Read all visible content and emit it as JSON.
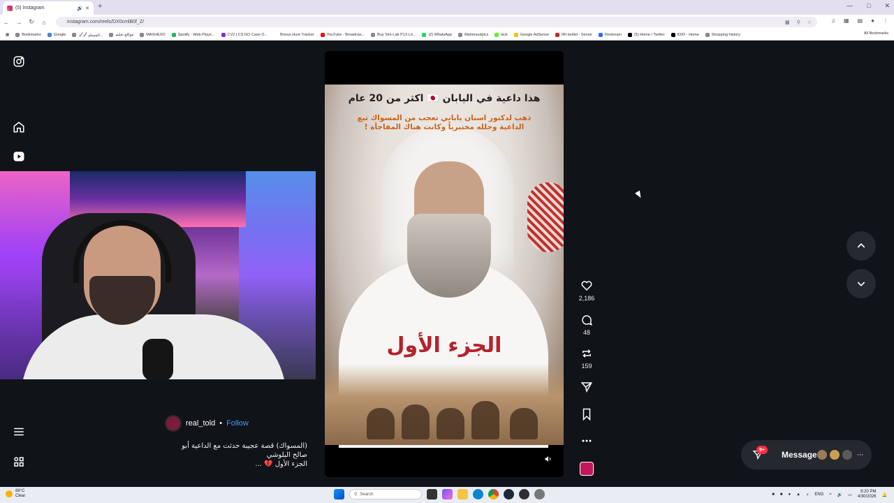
{
  "browser": {
    "tab_title": "(5) Instagram",
    "url": "instagram.com/reels/DX0cmlB0f_Z/",
    "bookmarks": [
      "Bookmarks",
      "Google",
      "المسلم ﷴﷴ...",
      "مواقع تعليم",
      "MAXHEXO",
      "Spotify - Web Playe...",
      "CV2 | CS:GO Case O...",
      "Bonus Hunt Tracker",
      "YouTube - Broadcas...",
      "Buy Sim-Lab P1X Lit...",
      "(2) WhatsApp",
      "Mahmoudpics",
      "kick",
      "Google AdSense",
      "IRI toolkit - Server",
      "Restream",
      "(5) Home / Twitter",
      "IOIO - Home",
      "Shopping history"
    ],
    "all_bookmarks": "All Bookmarks"
  },
  "reel": {
    "overlay_title": "هذا داعية في اليابان 🇯🇵 اكثر من 20 عام",
    "overlay_sub": "ذهب لدكتور اسنان ياباني تعجب من المسواك تبع الداعية وحلله مختبرياً وكانت هناك المفاجأة !",
    "overlay_part": "الجزء الأول",
    "likes": "2,186",
    "comments": "48",
    "reposts": "159"
  },
  "author": {
    "handle": "real_told",
    "separator": "•",
    "follow": "Follow"
  },
  "caption": {
    "line1": "(المسواك) قصة عجيبة حدثت مع الداعية أبو",
    "line2": "صالح البلوشي",
    "line3": "الجزء الأول 💔 ..."
  },
  "messages": {
    "label": "Messages",
    "badge": "9+",
    "more": "···"
  },
  "taskbar": {
    "temp": "88°C",
    "weather": "Clear",
    "search": "Search",
    "lang": "ENG",
    "time": "8:20 PM",
    "date": "4/30/2026"
  }
}
